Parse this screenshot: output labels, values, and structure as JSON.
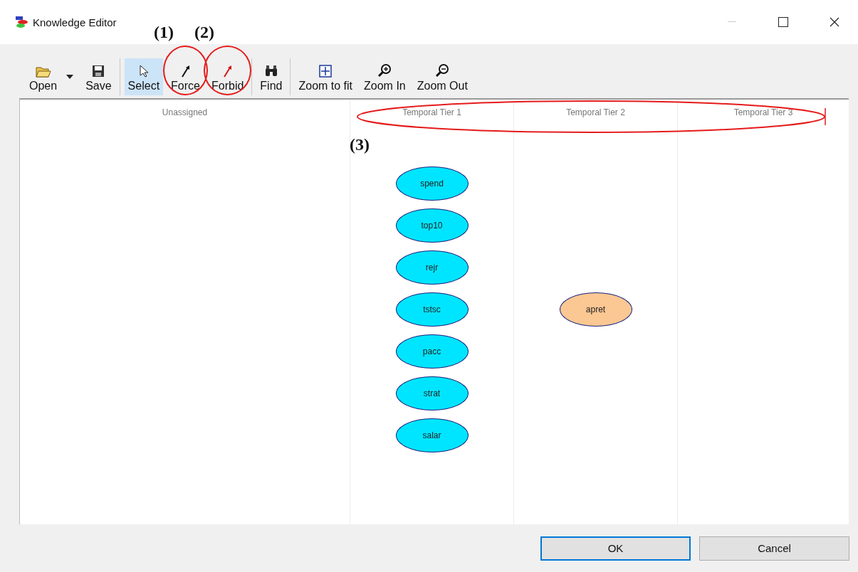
{
  "window": {
    "title": "Knowledge Editor"
  },
  "toolbar": {
    "groups": [
      [
        {
          "label": "Open",
          "kind": "open",
          "selected": false,
          "dropdown": true
        },
        {
          "label": "Save",
          "kind": "save",
          "selected": false
        }
      ],
      [
        {
          "label": "Select",
          "kind": "select",
          "selected": true
        },
        {
          "label": "Force",
          "kind": "force",
          "selected": false,
          "annotation": "(1)"
        },
        {
          "label": "Forbid",
          "kind": "forbid",
          "selected": false,
          "annotation": "(2)"
        }
      ],
      [
        {
          "label": "Find",
          "kind": "find",
          "selected": false
        }
      ],
      [
        {
          "label": "Zoom to fit",
          "kind": "fit",
          "selected": false
        },
        {
          "label": "Zoom In",
          "kind": "zoomin",
          "selected": false
        },
        {
          "label": "Zoom Out",
          "kind": "zoomout",
          "selected": false
        }
      ]
    ]
  },
  "canvas": {
    "tiers_annotation": "(3)",
    "columns": [
      {
        "title": "Unassigned"
      },
      {
        "title": "Temporal Tier 1",
        "nodes": [
          {
            "label": "spend",
            "color": "#00e5ff"
          },
          {
            "label": "top10",
            "color": "#00e5ff"
          },
          {
            "label": "rejr",
            "color": "#00e5ff"
          },
          {
            "label": "tstsc",
            "color": "#00e5ff"
          },
          {
            "label": "pacc",
            "color": "#00e5ff"
          },
          {
            "label": "strat",
            "color": "#00e5ff"
          },
          {
            "label": "salar",
            "color": "#00e5ff"
          }
        ]
      },
      {
        "title": "Temporal Tier 2",
        "nodes": [
          {
            "label": "apret",
            "color": "#fbc793"
          }
        ]
      },
      {
        "title": "Temporal Tier 3"
      }
    ]
  },
  "buttons": [
    {
      "label": "OK",
      "selected": true
    },
    {
      "label": "Cancel",
      "selected": false
    }
  ]
}
